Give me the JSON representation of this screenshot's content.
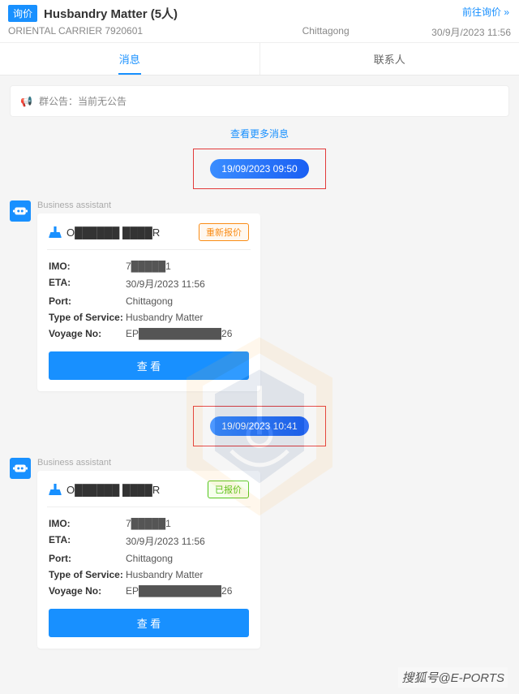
{
  "header": {
    "tag": "询价",
    "title": "Husbandry Matter (5人)",
    "goto_label": "前往询价",
    "sub_left": "ORIENTAL CARRIER 7920601",
    "sub_mid": "Chittagong",
    "sub_right": "30/9月/2023 11:56"
  },
  "tabs": {
    "messages": "消息",
    "contacts": "联系人"
  },
  "announce": {
    "prefix": "群公告：",
    "text": "当前无公告"
  },
  "more_link": "查看更多消息",
  "timestamps": {
    "t1": "19/09/2023 09:50",
    "t2": "19/09/2023 10:41"
  },
  "sender_name": "Business assistant",
  "card1": {
    "vessel": "O██████ ████R",
    "status": "重新报价",
    "fields": {
      "imo_label": "IMO:",
      "imo_value": "7█████1",
      "eta_label": "ETA:",
      "eta_value": "30/9月/2023 11:56",
      "port_label": "Port:",
      "port_value": "Chittagong",
      "tos_label": "Type of Service:",
      "tos_value": "Husbandry Matter",
      "voy_label": "Voyage No:",
      "voy_value": "EP████████████26"
    },
    "button": "查 看"
  },
  "card2": {
    "vessel": "O██████ ████R",
    "status": "已报价",
    "fields": {
      "imo_label": "IMO:",
      "imo_value": "7█████1",
      "eta_label": "ETA:",
      "eta_value": "30/9月/2023 11:56",
      "port_label": "Port:",
      "port_value": "Chittagong",
      "tos_label": "Type of Service:",
      "tos_value": "Husbandry Matter",
      "voy_label": "Voyage No:",
      "voy_value": "EP████████████26"
    },
    "button": "查 看"
  },
  "footer_watermark": "搜狐号@E-PORTS"
}
